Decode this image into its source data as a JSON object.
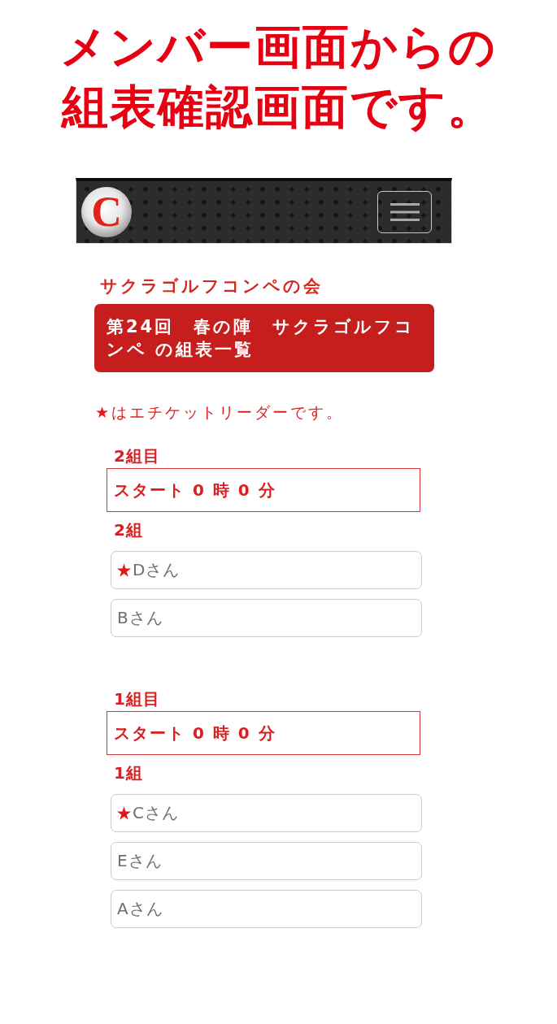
{
  "headline": [
    "メンバー画面からの",
    "組表確認画面です。"
  ],
  "header": {
    "logo": "C"
  },
  "club_name": "サクラゴルフコンペの会",
  "title": "第24回　春の陣　サクラゴルフコンペ の組表一覧",
  "legend": "★はエチケットリーダーです。",
  "groups": [
    {
      "heading": "2組目",
      "start_time": "スタート 0 時 0 分",
      "name": "2組",
      "members": [
        {
          "name": "Dさん",
          "leader": true
        },
        {
          "name": "Bさん",
          "leader": false
        }
      ]
    },
    {
      "heading": "1組目",
      "start_time": "スタート 0 時 0 分",
      "name": "1組",
      "members": [
        {
          "name": "Cさん",
          "leader": true
        },
        {
          "name": "Eさん",
          "leader": false
        },
        {
          "name": "Aさん",
          "leader": false
        }
      ]
    }
  ]
}
